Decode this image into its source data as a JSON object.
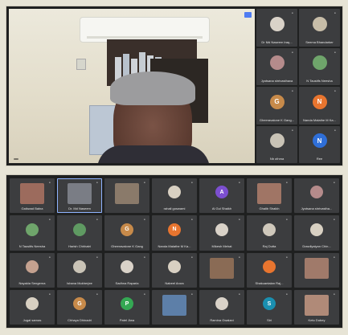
{
  "top": {
    "speaker_name": "",
    "tiles": [
      {
        "name": "Dr Md Naseem Iraq...",
        "initial": "",
        "color": "#d9d2c8",
        "kind": "photo"
      },
      {
        "name": "Seema Bhandarker",
        "initial": "",
        "color": "#c7bda8",
        "kind": "photo"
      },
      {
        "name": "Jyotsana shrivasthava",
        "initial": "",
        "color": "#b58b8b",
        "kind": "photo"
      },
      {
        "name": "N Tausitfs Neesha",
        "initial": "",
        "color": "#6fa56b",
        "kind": "photo"
      },
      {
        "name": "Gheeravalone K Gang...",
        "initial": "G",
        "color": "#c78a4a",
        "kind": "letter"
      },
      {
        "name": "Nanda Malathe M Ka...",
        "initial": "N",
        "color": "#e8752f",
        "kind": "letter"
      },
      {
        "name": "Nb othma",
        "initial": "",
        "color": "#c9c3b6",
        "kind": "photo"
      },
      {
        "name": "Ree",
        "initial": "N",
        "color": "#2f6fd8",
        "kind": "letter"
      }
    ]
  },
  "bottom": {
    "tiles": [
      {
        "name": "Gaikwad Balna",
        "initial": "",
        "color": "#9c6b5d",
        "kind": "video"
      },
      {
        "name": "Dr. Md Naseem",
        "initial": "",
        "color": "#7a7d85",
        "kind": "video",
        "active": true
      },
      {
        "name": "",
        "initial": "",
        "color": "#8a7a6a",
        "kind": "video"
      },
      {
        "name": "rahali goswami",
        "initial": "",
        "color": "#d8d0c2",
        "kind": "photo"
      },
      {
        "name": "Al Gul Shaikh",
        "initial": "A",
        "color": "#7c4fd0",
        "kind": "letter"
      },
      {
        "name": "Ghalib Shaikh",
        "initial": "",
        "color": "#a07565",
        "kind": "video"
      },
      {
        "name": "Jyotsana shrivastha...",
        "initial": "",
        "color": "#b58b8b",
        "kind": "photo"
      },
      {
        "name": "N Tausitfs Neesha",
        "initial": "",
        "color": "#6fa56b",
        "kind": "photo"
      },
      {
        "name": "Harish Chhhatri",
        "initial": "",
        "color": "#5f9a62",
        "kind": "photo"
      },
      {
        "name": "Gheeravalone K Gang",
        "initial": "G",
        "color": "#c78a4a",
        "kind": "letter"
      },
      {
        "name": "Nanda Malathe M Ka...",
        "initial": "N",
        "color": "#e8752f",
        "kind": "letter"
      },
      {
        "name": "Mikesh Mehat",
        "initial": "",
        "color": "#d9d2c8",
        "kind": "photo"
      },
      {
        "name": "Raj Dutta",
        "initial": "",
        "color": "#cfc8bb",
        "kind": "photo"
      },
      {
        "name": "Dowdlyaiyan Chin...",
        "initial": "",
        "color": "#d8d0c2",
        "kind": "photo"
      },
      {
        "name": "Nayakia Sengerna",
        "initial": "",
        "color": "#c4a18f",
        "kind": "photo"
      },
      {
        "name": "Ishana Mukherjee",
        "initial": "",
        "color": "#c9c3b6",
        "kind": "photo"
      },
      {
        "name": "Sadhna Raparia",
        "initial": "",
        "color": "#d9d2c8",
        "kind": "photo"
      },
      {
        "name": "Nabeel Arora",
        "initial": "",
        "color": "#d8d0c2",
        "kind": "photo"
      },
      {
        "name": "",
        "initial": "",
        "color": "#8a6b55",
        "kind": "video"
      },
      {
        "name": "Shakuantalan Raj...",
        "initial": "",
        "color": "#e8752f",
        "kind": "photo"
      },
      {
        "name": "",
        "initial": "",
        "color": "#a07a6a",
        "kind": "video"
      },
      {
        "name": "Jugal sarnas",
        "initial": "",
        "color": "#d8d0c2",
        "kind": "photo"
      },
      {
        "name": "Chhaya Dhinadri",
        "initial": "G",
        "color": "#c78a4a",
        "kind": "letter"
      },
      {
        "name": "Patel Jiwa",
        "initial": "P",
        "color": "#34a853",
        "kind": "letter"
      },
      {
        "name": "",
        "initial": "",
        "color": "#5d7fa8",
        "kind": "video"
      },
      {
        "name": "Ramina Gwalani",
        "initial": "",
        "color": "#d9d2c8",
        "kind": "photo"
      },
      {
        "name": "Siri",
        "initial": "S",
        "color": "#1a8fb0",
        "kind": "letter"
      },
      {
        "name": "Ketu Dubey",
        "initial": "",
        "color": "#b08a78",
        "kind": "video"
      }
    ]
  }
}
